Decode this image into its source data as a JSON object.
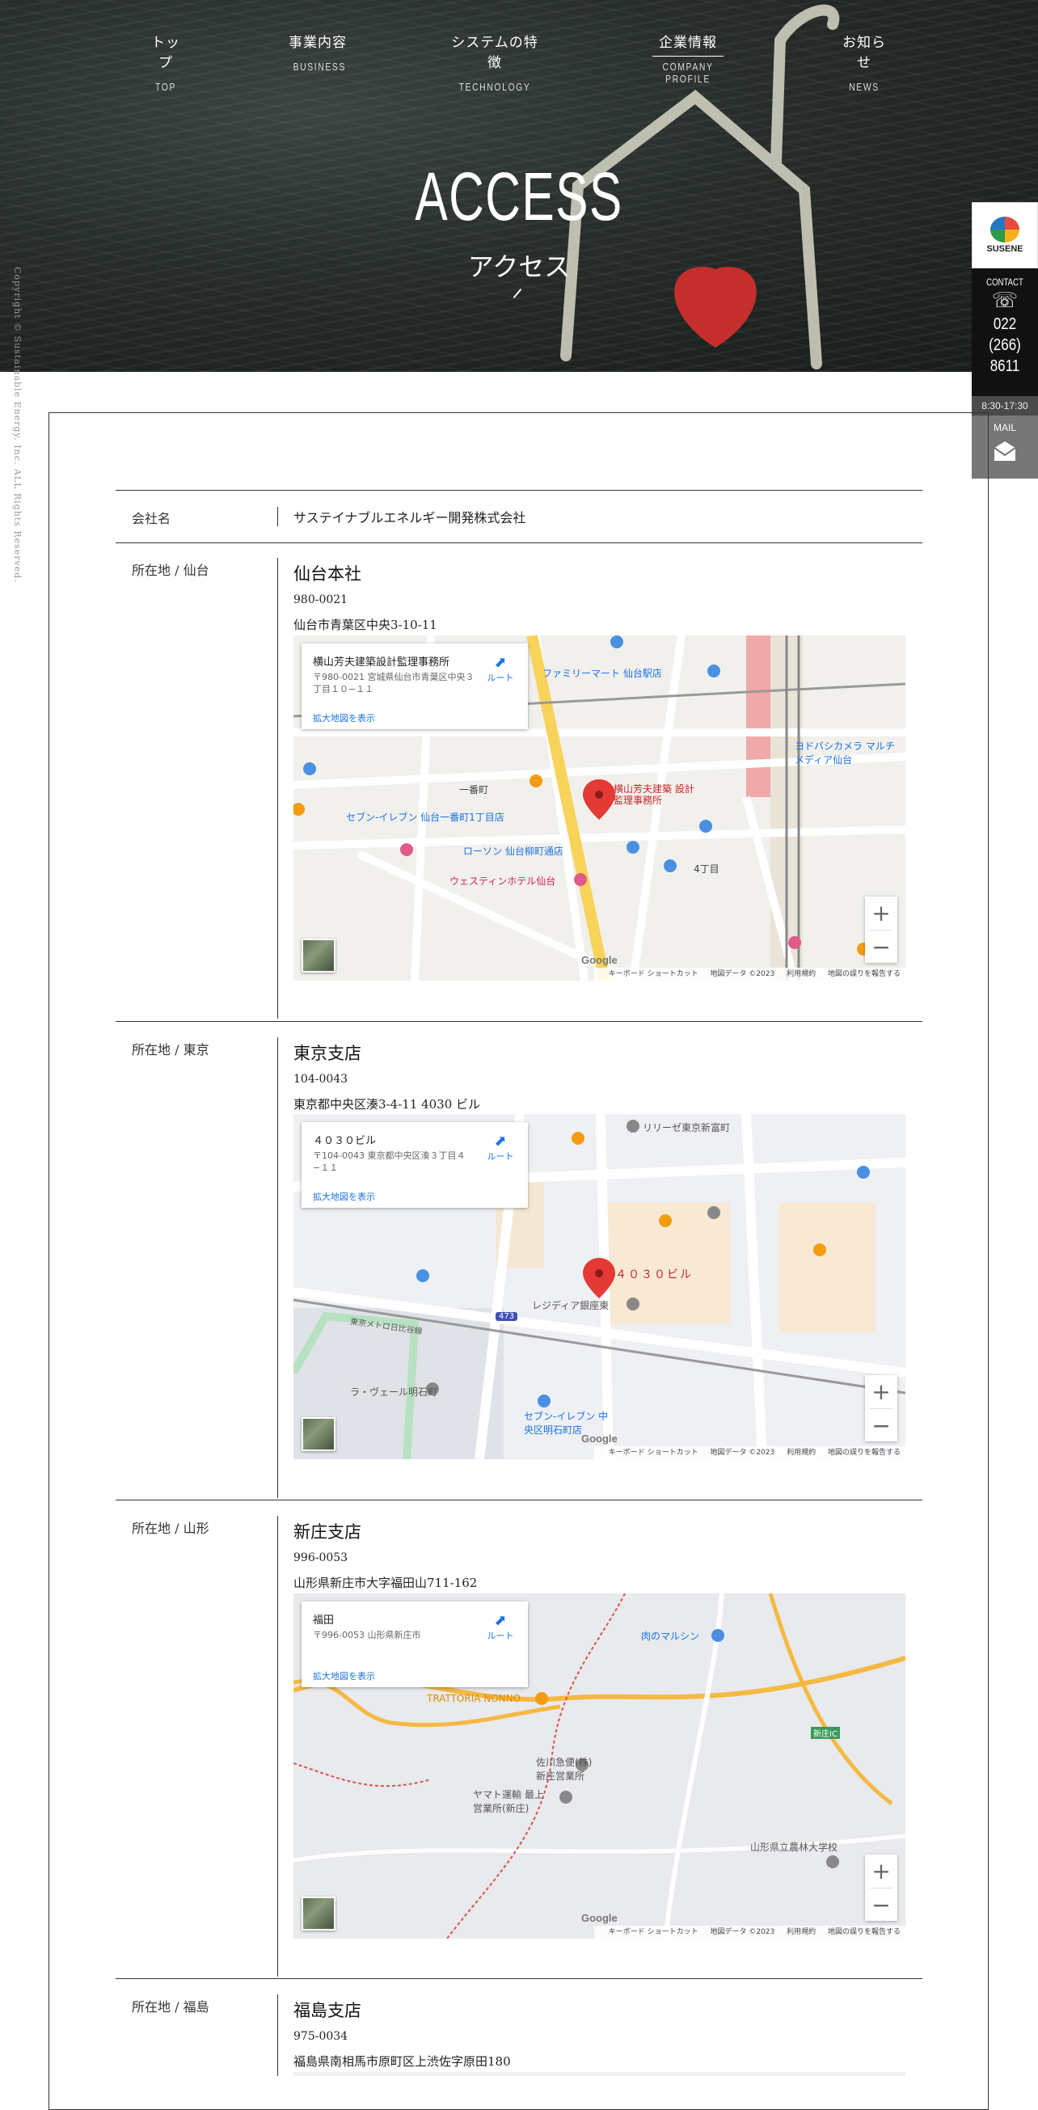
{
  "nav": [
    {
      "jp": "トップ",
      "en": "TOP"
    },
    {
      "jp": "事業内容",
      "en": "BUSINESS"
    },
    {
      "jp": "システムの特徴",
      "en": "TECHNOLOGY"
    },
    {
      "jp": "企業情報",
      "en": "COMPANY PROFILE"
    },
    {
      "jp": "お知らせ",
      "en": "NEWS"
    }
  ],
  "hero": {
    "title": "ACCESS",
    "subtitle": "アクセス"
  },
  "copyright": "Copyright © Sustainable Energy, Inc. ALL Rights Reserved.",
  "side": {
    "logo_text": "SUSENE",
    "contact_label": "CONTACT",
    "tel": [
      "022",
      "(266)",
      "8611"
    ],
    "hours": "8:30-17:30",
    "mail_label": "MAIL"
  },
  "company": {
    "label": "会社名",
    "value": "サステイナブルエネルギー開発株式会社"
  },
  "offices": [
    {
      "label": "所在地 / 仙台",
      "name": "仙台本社",
      "zip": "980-0021",
      "address": "仙台市青葉区中央3-10-11",
      "map": {
        "place": "横山芳夫建築設計監理事務所",
        "place_address": "〒980-0021 宮城県仙台市青葉区中央３丁目１０−１１",
        "pin_label": "横山芳夫建築 設計監理事務所",
        "labels": [
          "ファミリーマート 仙台駅店",
          "セブン-イレブン 仙台一番町1丁目店",
          "ローソン 仙台柳町通店",
          "ウェスティンホテル仙台",
          "ヨドバシカメラ マルチメディア仙台",
          "一番町",
          "4丁目"
        ]
      }
    },
    {
      "label": "所在地 / 東京",
      "name": "東京支店",
      "zip": "104-0043",
      "address": "東京都中央区湊3-4-11 4030 ビル",
      "map": {
        "place": "４０３０ビル",
        "place_address": "〒104-0043 東京都中央区湊３丁目４−１１",
        "pin_label": "４０３０ビル",
        "labels": [
          "リリーゼ東京新富町",
          "レジディア銀座東",
          "ラ・ヴェール明石町",
          "東京メトロ日比谷線",
          "セブン-イレブン 中央区明石町店",
          "473"
        ]
      }
    },
    {
      "label": "所在地 / 山形",
      "name": "新庄支店",
      "zip": "996-0053",
      "address": "山形県新庄市大字福田山711-162",
      "map": {
        "place": "福田",
        "place_address": "〒996-0053 山形県新庄市",
        "pin_label": "",
        "labels": [
          "TRATTORIA NONNO",
          "佐川急便(株) 新庄営業所",
          "ヤマト運輸 最上 営業所(新庄)",
          "山形県立農林大学校",
          "肉のマルシン",
          "新庄IC"
        ]
      }
    },
    {
      "label": "所在地 / 福島",
      "name": "福島支店",
      "zip": "975-0034",
      "address": "福島県南相馬市原町区上渋佐字原田180"
    }
  ],
  "map_common": {
    "enlarge": "拡大地図を表示",
    "route": "ルート",
    "google": "Google",
    "footer": [
      "キーボード ショートカット",
      "地図データ ©2023",
      "利用規約",
      "地図の誤りを報告する"
    ]
  }
}
